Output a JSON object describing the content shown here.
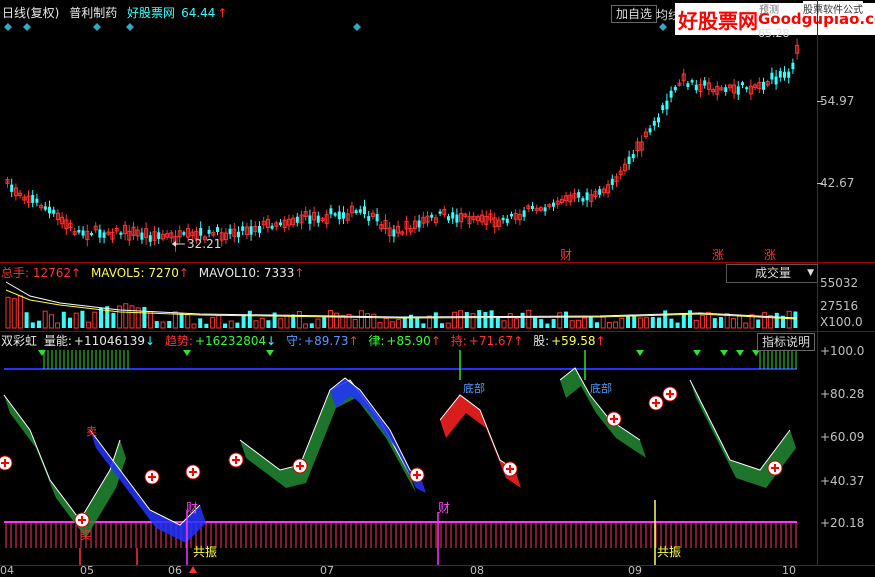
{
  "header": {
    "period": "日线(复权)",
    "stock": "普利制药",
    "site_label": "好股票网",
    "price": "64.44",
    "add_button": "加自选",
    "ma_label": "均线"
  },
  "watermark": {
    "brand": "好股票网",
    "domain": "Goodgupiao.com",
    "tagline": "股票软件公式",
    "partial_text": "预测"
  },
  "price_axis": {
    "labels": [
      "54.97",
      "42.67"
    ],
    "low_marker": "32.21",
    "partial_high": "65.28"
  },
  "price_annotations": [
    "财",
    "涨",
    "涨"
  ],
  "volume": {
    "total_label": "总手: 12762",
    "ma5_label": "MAVOL5: 7270",
    "ma10_label": "MAVOL10: 7333",
    "selector": "成交量",
    "axis": [
      "55032",
      "27516",
      "X100.0"
    ]
  },
  "indicator": {
    "name": "双彩虹",
    "fields": [
      {
        "label": "量能:",
        "value": "+11046139",
        "arrow": "↓"
      },
      {
        "label": "趋势:",
        "value": "+16232804",
        "arrow": "↓"
      },
      {
        "label": "守:",
        "value": "+89.73",
        "arrow": "↑"
      },
      {
        "label": "律:",
        "value": "+85.90",
        "arrow": "↑"
      },
      {
        "label": "持:",
        "value": "+71.67",
        "arrow": "↑"
      },
      {
        "label": "股:",
        "value": "+59.58",
        "arrow": "↑"
      }
    ],
    "help_button": "指标说明",
    "axis": [
      "+100.0",
      "+80.28",
      "+60.09",
      "+40.37",
      "+20.18"
    ],
    "annotations": [
      "财",
      "财",
      "共振",
      "共振",
      "底部",
      "底部",
      "卖",
      "买"
    ]
  },
  "date_axis": [
    "04",
    "05",
    "06",
    "07",
    "08",
    "09",
    "10"
  ],
  "colors": {
    "up": "#ff3333",
    "down": "#33ffff",
    "axis": "#c0c0c0",
    "level_line": "#2233ff"
  }
}
